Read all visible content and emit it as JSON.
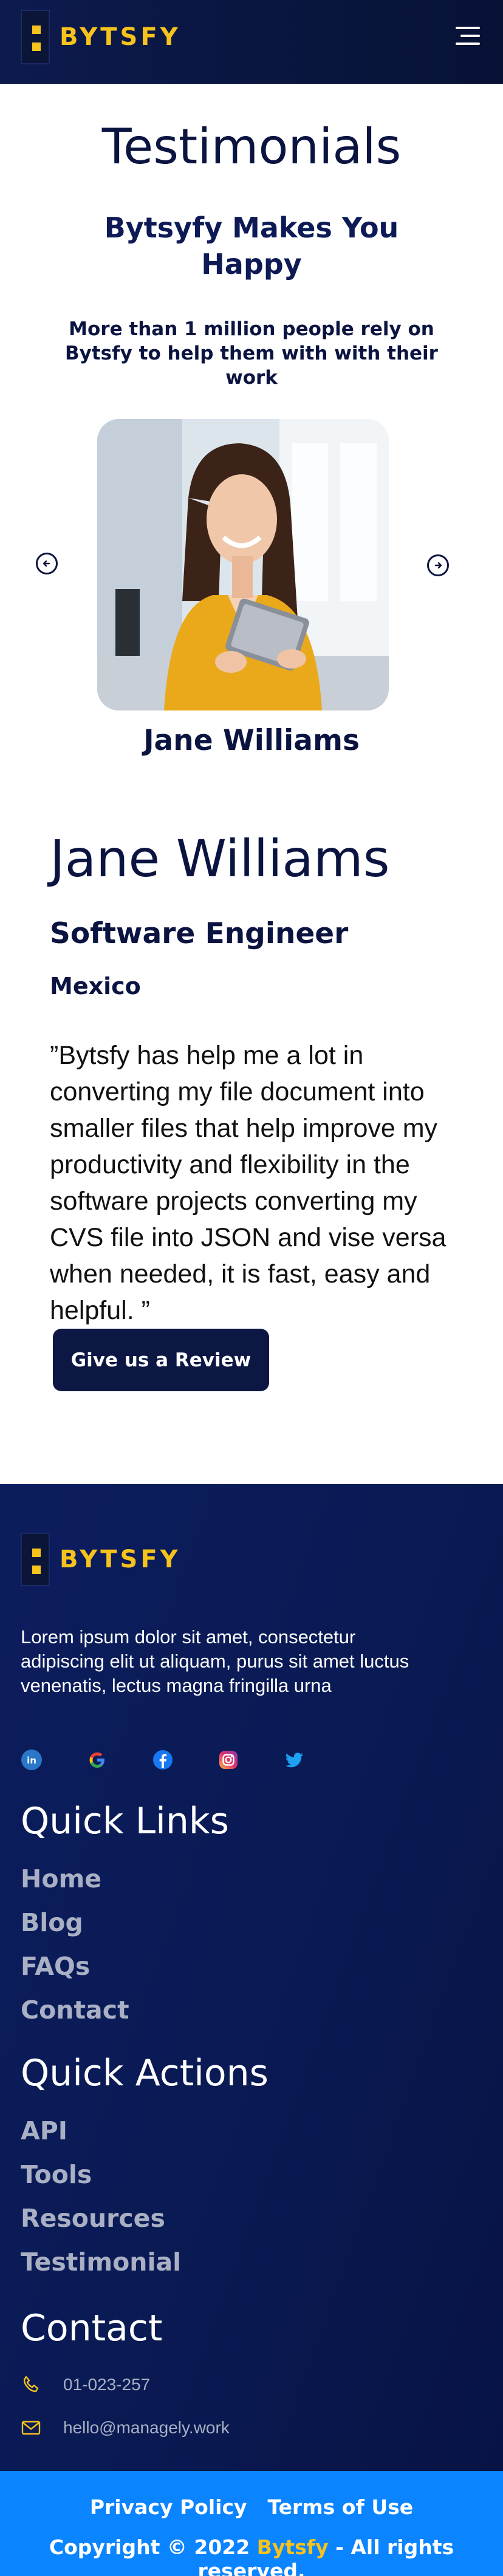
{
  "header": {
    "logo_text": "BYTSFY",
    "brand_color": "#f6c21c",
    "menu_icon": "hamburger-menu-icon"
  },
  "testimonials": {
    "title": "Testimonials",
    "subtitle": "Bytsyfy Makes You Happy",
    "description": "More than 1 million people rely on Bytsfy to help them with with their work",
    "prev_icon": "arrow-left-circle-icon",
    "next_icon": "arrow-right-circle-icon",
    "current_name": "Jane Williams"
  },
  "detail": {
    "name": "Jane Williams",
    "role": "Software Engineer",
    "country": "Mexico",
    "quote": "”Bytsfy has help me a lot in converting my file document into smaller files that help improve my productivity and flexibility in the software projects converting my CVS file into JSON and vise versa when needed, it is fast, easy and helpful. ”",
    "review_button": "Give us a Review"
  },
  "footer": {
    "logo_text": "BYTSFY",
    "about": "Lorem ipsum dolor sit amet, consectetur adipiscing elit ut aliquam, purus sit amet luctus venenatis, lectus magna fringilla urna",
    "socials": [
      "linkedin-icon",
      "google-icon",
      "facebook-icon",
      "instagram-icon",
      "twitter-icon"
    ],
    "quick_links_title": "Quick Links",
    "quick_links": [
      "Home",
      "Blog",
      "FAQs",
      "Contact"
    ],
    "quick_actions_title": "Quick Actions",
    "quick_actions": [
      "API",
      "Tools",
      "Resources",
      "Testimonial"
    ],
    "contact_title": "Contact",
    "phone": "01-023-257",
    "email": "hello@managely.work"
  },
  "bottom_bar": {
    "privacy": "Privacy Policy",
    "terms": "Terms of Use",
    "copyright_prefix": "Copyright © 2022",
    "copyright_brand": "Bytsfy",
    "copyright_suffix": "- All rights reserved.",
    "bar_color": "#0a84ff"
  }
}
